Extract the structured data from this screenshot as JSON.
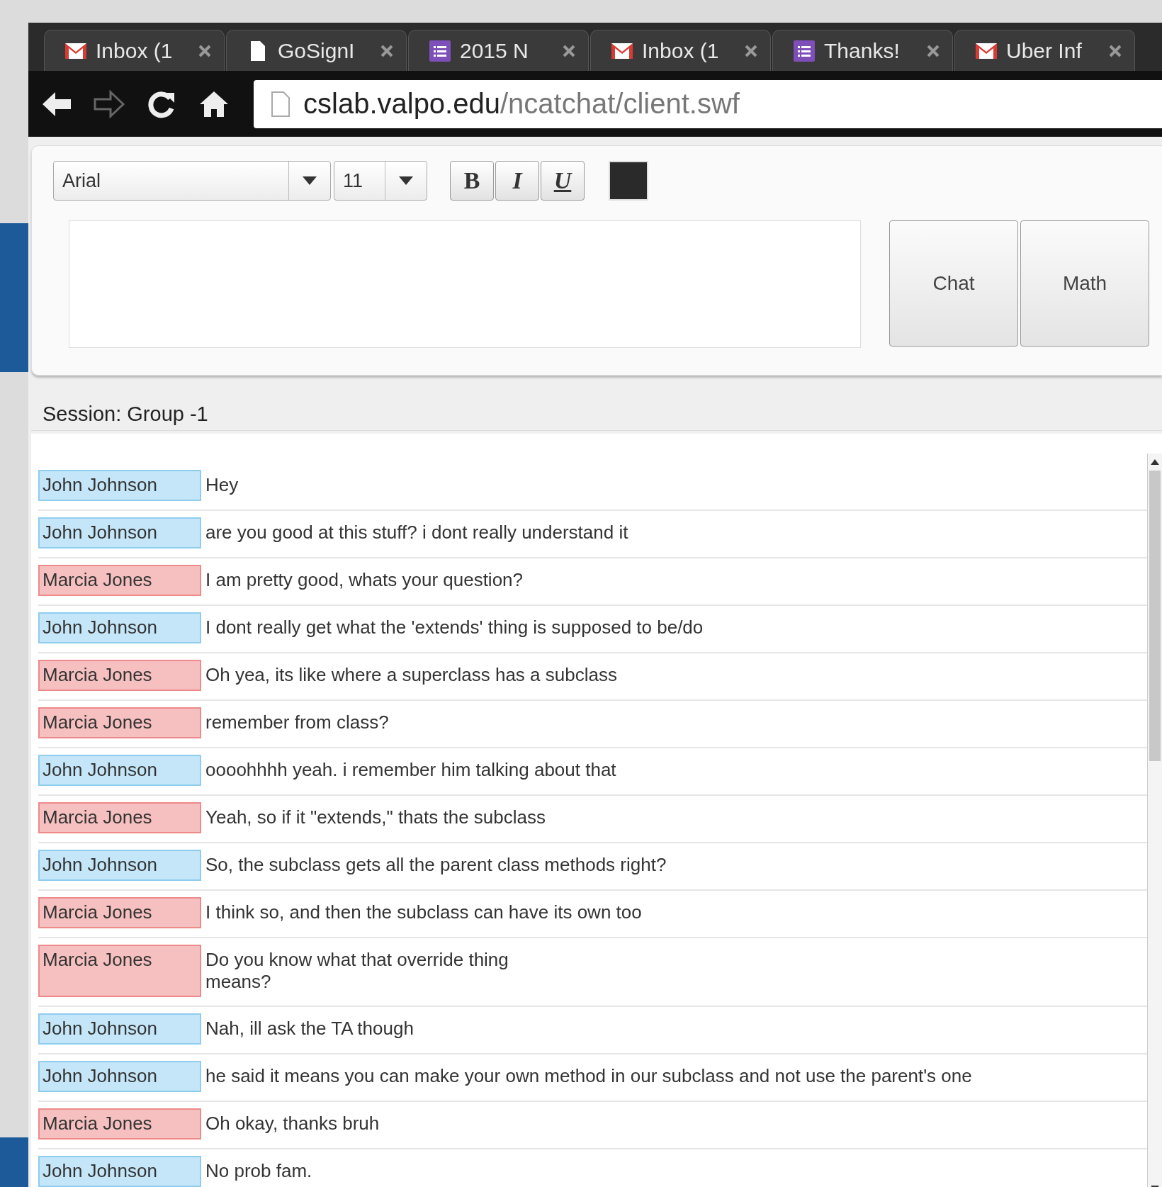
{
  "browser": {
    "tabs": [
      {
        "kind": "mail",
        "title": "Inbox (1",
        "selected": false
      },
      {
        "kind": "page",
        "title": "GoSignI",
        "selected": false
      },
      {
        "kind": "list",
        "title": "2015 N",
        "selected": false
      },
      {
        "kind": "mail",
        "title": "Inbox (1",
        "selected": false
      },
      {
        "kind": "list",
        "title": "Thanks!",
        "selected": false
      },
      {
        "kind": "mail",
        "title": "Uber Inf",
        "selected": false
      }
    ],
    "address": {
      "host": "cslab.valpo.edu",
      "path": "/ncatchat/client.swf"
    }
  },
  "editor": {
    "font": "Arial",
    "size": "11",
    "format_buttons": [
      "B",
      "I",
      "U"
    ],
    "buttons": [
      "Chat",
      "Math"
    ]
  },
  "session": "Session: Group -1",
  "messages": [
    {
      "sender": "John Johnson",
      "color": "#c4e6f8",
      "text": "Hey"
    },
    {
      "sender": "John Johnson",
      "color": "#c4e6f8",
      "text": "are you good at this stuff? i dont really understand it"
    },
    {
      "sender": "Marcia Jones",
      "color": "#f7c0c0",
      "text": "I am pretty good, whats your question?"
    },
    {
      "sender": "John Johnson",
      "color": "#c4e6f8",
      "text": "I dont really get what the 'extends' thing is supposed to be/do"
    },
    {
      "sender": "Marcia Jones",
      "color": "#f7c0c0",
      "text": "Oh yea, its like where a superclass has a subclass"
    },
    {
      "sender": "Marcia Jones",
      "color": "#f7c0c0",
      "text": "remember from class?"
    },
    {
      "sender": "John Johnson",
      "color": "#c4e6f8",
      "text": "oooohhhh yeah. i remember him talking about that"
    },
    {
      "sender": "Marcia Jones",
      "color": "#f7c0c0",
      "text": "Yeah, so if it \"extends,\" thats the subclass"
    },
    {
      "sender": "John Johnson",
      "color": "#c4e6f8",
      "text": "So, the subclass gets all the parent class methods right?"
    },
    {
      "sender": "Marcia Jones",
      "color": "#f7c0c0",
      "text": "I think so, and then the subclass can have its own too"
    },
    {
      "sender": "Marcia Jones",
      "color": "#f7c0c0",
      "text": "Do you know what that override thing\nmeans?"
    },
    {
      "sender": "John Johnson",
      "color": "#c4e6f8",
      "text": "Nah, ill ask the TA though"
    },
    {
      "sender": "John Johnson",
      "color": "#c4e6f8",
      "text": "he said it means you can make your own method in our subclass and not use the parent's one"
    },
    {
      "sender": "Marcia Jones",
      "color": "#f7c0c0",
      "text": "Oh okay, thanks bruh"
    },
    {
      "sender": "John Johnson",
      "color": "#c4e6f8",
      "text": "No prob fam."
    }
  ]
}
